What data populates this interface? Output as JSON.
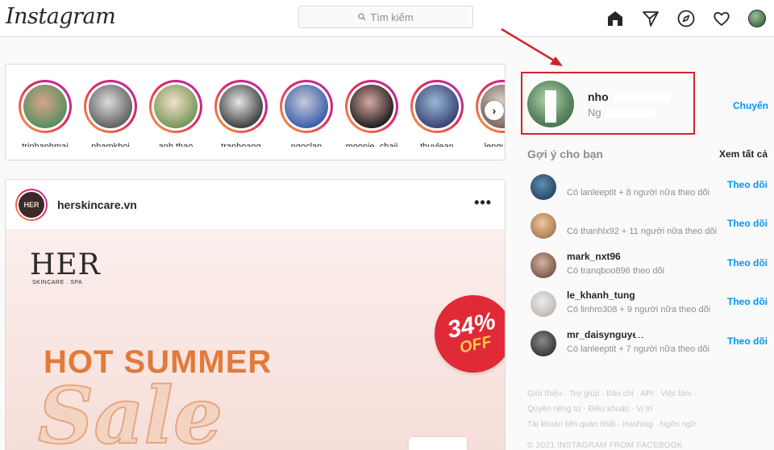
{
  "header": {
    "logo": "Instagram",
    "search_placeholder": "Tìm kiếm",
    "icons": [
      "home-icon",
      "direct-message-icon",
      "explore-icon",
      "activity-heart-icon",
      "profile-avatar"
    ]
  },
  "stories": [
    {
      "name": "trinhanhmai",
      "colors": [
        "#d9a58a",
        "#4b8c5a"
      ]
    },
    {
      "name": "phamkhoi",
      "colors": [
        "#dcdcdc",
        "#555555"
      ]
    },
    {
      "name": "anh.thao",
      "colors": [
        "#f2e2c8",
        "#6b8e4e"
      ]
    },
    {
      "name": "tranhoang",
      "colors": [
        "#e6e6e6",
        "#2f2f2f"
      ]
    },
    {
      "name": "ngoclan",
      "colors": [
        "#c9c9d6",
        "#2d55a8"
      ]
    },
    {
      "name": "moonie_chaii",
      "colors": [
        "#d8a9a4",
        "#111111"
      ]
    },
    {
      "name": "thuylean",
      "colors": [
        "#9bb7d4",
        "#2e3a6b"
      ]
    },
    {
      "name": "lenguche",
      "colors": [
        "#e0d4cc",
        "#6d5b52"
      ]
    }
  ],
  "post": {
    "username": "herskincare.vn",
    "brand": "HER",
    "brand_sub": "SKINCARE . SPA",
    "discount": "34%",
    "discount_off": "OFF",
    "headline": "HOT SUMMER",
    "script": "Sale"
  },
  "profile": {
    "name": "nho",
    "sub": "Ng",
    "switch_label": "Chuyển"
  },
  "suggestions": {
    "title": "Gợi ý cho bạn",
    "see_all": "Xem tất cả",
    "follow_label": "Theo dõi",
    "items": [
      {
        "name": "",
        "sub": "Có lanleeptit + 8 người nữa theo dõi",
        "avatar_colors": [
          "#5f8fb2",
          "#1f3b5a"
        ]
      },
      {
        "name": "",
        "sub": "Có thanhlx92 + 11 người nữa theo dõi",
        "avatar_colors": [
          "#f2c79c",
          "#a06e4a"
        ]
      },
      {
        "name": "mark_nxt96",
        "sub": "Có tranqboo896 theo dõi",
        "avatar_colors": [
          "#d7b4a3",
          "#6a4b3d"
        ]
      },
      {
        "name": "le_khanh_tung",
        "sub": "Có linhro308 + 9 người nữa theo dõi",
        "avatar_colors": [
          "#ececec",
          "#b9b2a8"
        ]
      },
      {
        "name": "mr_daisynguyen",
        "sub": "Có lanleeptit + 7 người nữa theo dõi",
        "avatar_colors": [
          "#8a8a8a",
          "#2a2a2a"
        ]
      }
    ]
  },
  "footer": {
    "links_line1": "Giới thiệu · Trợ giúp · Báo chí · API · Việc làm ·",
    "links_line2": "Quyền riêng tư · Điều khoản · Vị trí ·",
    "links_line3": "Tài khoản liên quan nhất · Hashtag · Ngôn ngữ",
    "copyright": "© 2021 INSTAGRAM FROM FACEBOOK"
  },
  "colors": {
    "accent": "#0095f6",
    "annotation": "#d2232a",
    "story_ring": "#e0245e",
    "border": "#dbdbdb"
  }
}
